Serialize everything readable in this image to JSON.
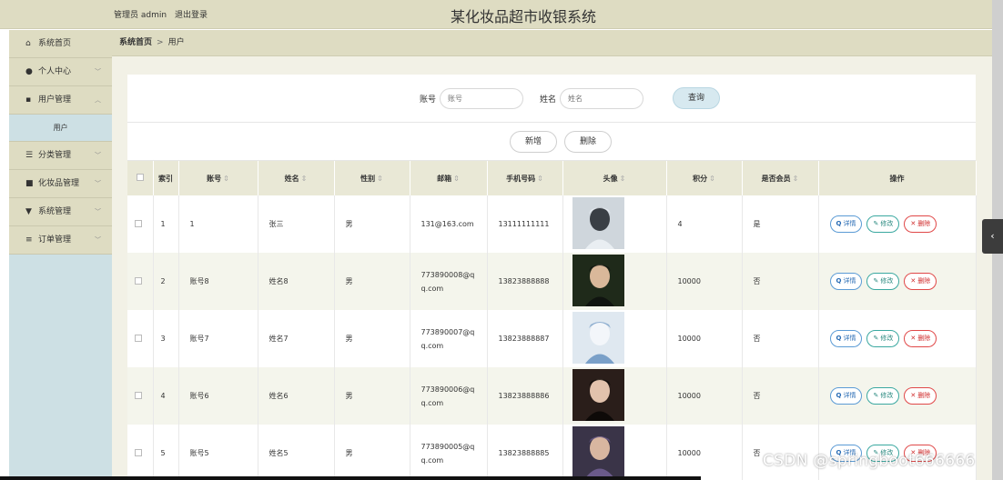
{
  "header": {
    "admin_label": "管理员 admin",
    "logout_label": "退出登录",
    "title": "某化妆品超市收银系统"
  },
  "sidebar": {
    "items": [
      {
        "label": "系统首页",
        "icon": "home-icon",
        "glyph": "⌂",
        "chevron": ""
      },
      {
        "label": "个人中心",
        "icon": "user-icon",
        "glyph": "●",
        "chevron": "﹀"
      },
      {
        "label": "用户管理",
        "icon": "grid-icon",
        "glyph": "▪",
        "chevron": "︿"
      },
      {
        "label": "分类管理",
        "icon": "sliders-icon",
        "glyph": "☰",
        "chevron": "﹀"
      },
      {
        "label": "化妆品管理",
        "icon": "box-icon",
        "glyph": "■",
        "chevron": "﹀"
      },
      {
        "label": "系统管理",
        "icon": "filter-icon",
        "glyph": "▼",
        "chevron": "﹀"
      },
      {
        "label": "订单管理",
        "icon": "list-icon",
        "glyph": "≡",
        "chevron": "﹀"
      }
    ],
    "sub_item": "用户"
  },
  "breadcrumb": {
    "home": "系统首页",
    "separator": ">",
    "current": "用户"
  },
  "search": {
    "account_label": "账号",
    "account_placeholder": "账号",
    "name_label": "姓名",
    "name_placeholder": "姓名",
    "query_button": "查询"
  },
  "actions": {
    "add_button": "新增",
    "delete_button": "删除"
  },
  "table": {
    "headers": [
      "索引",
      "账号",
      "姓名",
      "性别",
      "邮箱",
      "手机号码",
      "头像",
      "积分",
      "是否会员",
      "操作"
    ],
    "sortable_glyph": "⇕",
    "rows": [
      {
        "no": "1",
        "account": "1",
        "name": "张三",
        "gender": "男",
        "email": "131@163.com",
        "phone": "13111111111",
        "points": "4",
        "member": "是"
      },
      {
        "no": "2",
        "account": "账号8",
        "name": "姓名8",
        "gender": "男",
        "email": "773890008@qq.com",
        "phone": "13823888888",
        "points": "10000",
        "member": "否"
      },
      {
        "no": "3",
        "account": "账号7",
        "name": "姓名7",
        "gender": "男",
        "email": "773890007@qq.com",
        "phone": "13823888887",
        "points": "10000",
        "member": "否"
      },
      {
        "no": "4",
        "account": "账号6",
        "name": "姓名6",
        "gender": "男",
        "email": "773890006@qq.com",
        "phone": "13823888886",
        "points": "10000",
        "member": "否"
      },
      {
        "no": "5",
        "account": "账号5",
        "name": "姓名5",
        "gender": "男",
        "email": "773890005@qq.com",
        "phone": "13823888885",
        "points": "10000",
        "member": "否"
      }
    ],
    "op_detail": "详情",
    "op_edit": "修改",
    "op_delete": "删除"
  },
  "watermark": "CSDN @springboot666666"
}
